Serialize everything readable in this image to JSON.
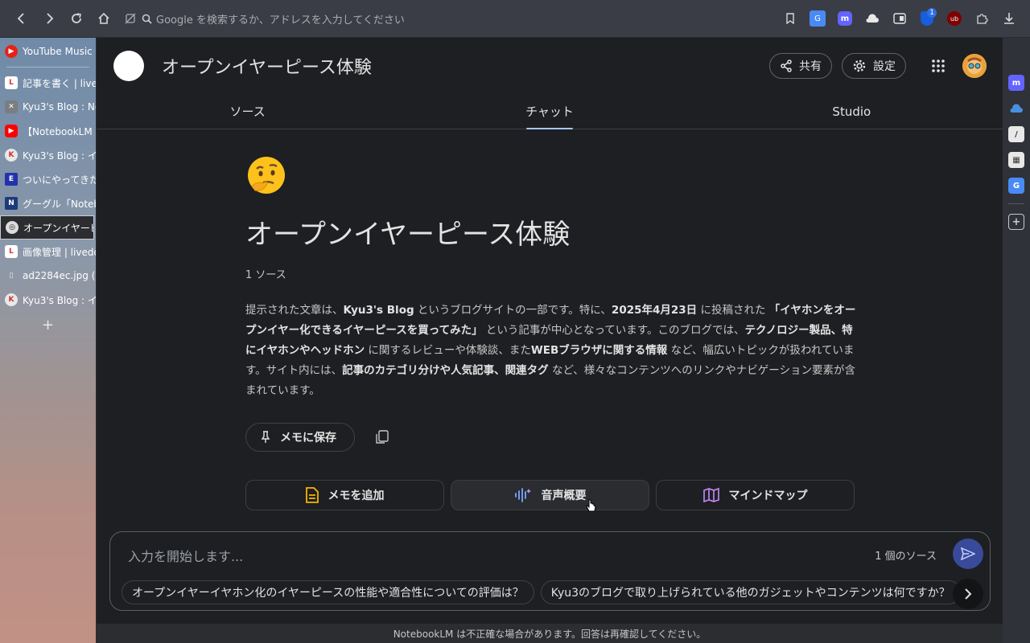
{
  "browser": {
    "address_placeholder": "Google を検索するか、アドレスを入力してください",
    "extension_badge": "1"
  },
  "tabs": [
    {
      "label": "YouTube Music",
      "fav_color": "#e62117"
    },
    {
      "label": "記事を書く | livedoor",
      "fav_color": "#e0322d"
    },
    {
      "label": "Kyu3's Blog : No",
      "fav_color": "#7a7d82"
    },
    {
      "label": "【NotebookLM",
      "fav_color": "#ff0000"
    },
    {
      "label": "Kyu3's Blog : イ",
      "fav_color": "#e8e8e8"
    },
    {
      "label": "ついにやってきた",
      "fav_color": "#2233aa"
    },
    {
      "label": "グーグル「Noteb",
      "fav_color": "#1d3a7a"
    },
    {
      "label": "オープンイヤーピ",
      "fav_color": "#dddddd"
    },
    {
      "label": "画像管理 | livedo",
      "fav_color": "#e0322d"
    },
    {
      "label": "ad2284ec.jpg (",
      "fav_color": "#cccccc"
    },
    {
      "label": "Kyu3's Blog : イ",
      "fav_color": "#e8e8e8"
    }
  ],
  "header": {
    "title": "オープンイヤーピース体験",
    "share_label": "共有",
    "settings_label": "設定"
  },
  "nav_tabs": {
    "sources": "ソース",
    "chat": "チャット",
    "studio": "Studio"
  },
  "notebook": {
    "title": "オープンイヤーピース体験",
    "source_count": "1 ソース",
    "summary": {
      "p1": "提示された文章は、",
      "b1": "Kyu3's Blog",
      "p2": " というブログサイトの一部です。特に、",
      "b2": "2025年4月23日",
      "p3": " に投稿された ",
      "b3": "「イヤホンをオープンイヤー化できるイヤーピースを買ってみた」",
      "p4": " という記事が中心となっています。このブログでは、",
      "b4": "テクノロジー製品、特にイヤホンやヘッドホン",
      "p5": " に関するレビューや体験談、また",
      "b5": "WEBブラウザに関する情報",
      "p6": " など、幅広いトピックが扱われています。サイト内には、",
      "b6": "記事のカテゴリ分けや人気記事、関連タグ",
      "p7": " など、様々なコンテンツへのリンクやナビゲーション要素が含まれています。"
    },
    "save_memo": "メモに保存",
    "add_memo": "メモを追加",
    "audio_overview": "音声概要",
    "mind_map": "マインドマップ"
  },
  "chat": {
    "placeholder": "入力を開始します...",
    "source_count": "1 個のソース",
    "suggestions": [
      "オープンイヤーイヤホン化のイヤーピースの性能や適合性についての評価は？",
      "Kyu3のブログで取り上げられている他のガジェットやコンテンツは何ですか？"
    ]
  },
  "footer": {
    "disclaimer": "NotebookLM は不正確な場合があります。回答は再確認してください。"
  },
  "colors": {
    "accent_tab": "#a8c7fa",
    "send_button": "#3a4a9a",
    "memo_icon": "#f6b400",
    "audio_icon": "#7aa7ff",
    "mindmap_icon": "#c58af9"
  }
}
